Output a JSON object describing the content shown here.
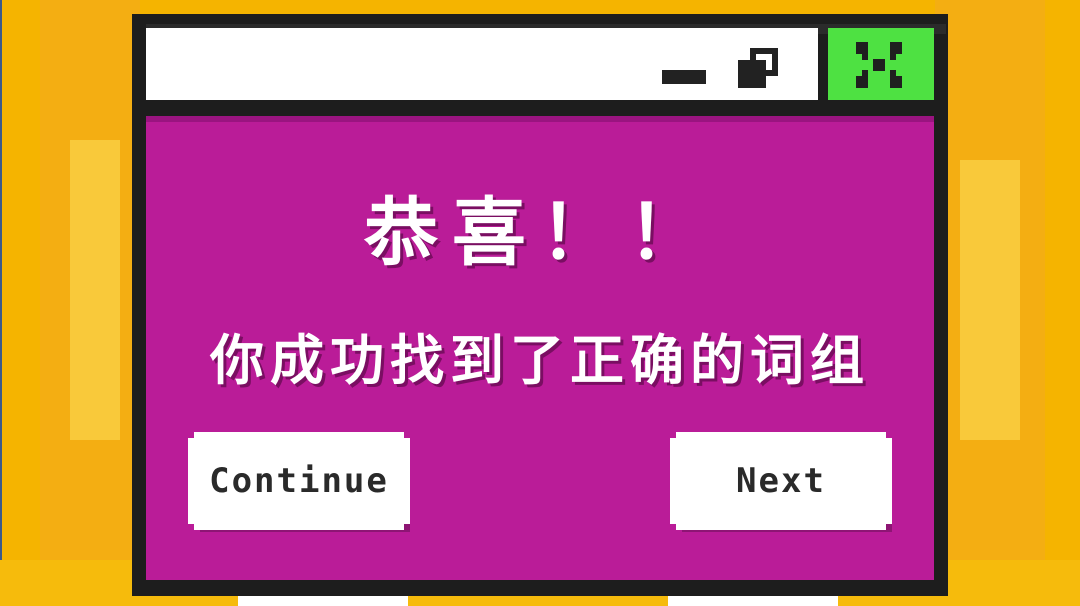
{
  "dialog": {
    "title": "恭喜！！",
    "message": "你成功找到了正确的词组"
  },
  "buttons": {
    "continue_label": "Continue",
    "next_label": "Next"
  },
  "icons": {
    "minimize": "minimize-icon",
    "restore": "restore-icon",
    "close": "close-icon"
  },
  "colors": {
    "background": "#f5b400",
    "panel": "#ba1c98",
    "close_button": "#4ee142",
    "titlebar": "#ffffff"
  }
}
